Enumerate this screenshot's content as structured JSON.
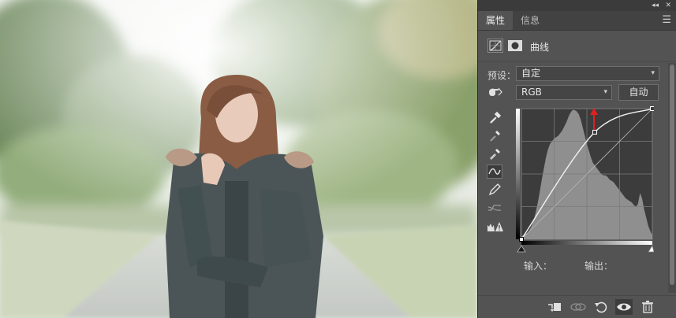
{
  "panel": {
    "tabs": [
      {
        "label": "属性"
      },
      {
        "label": "信息"
      }
    ],
    "adjustment_title": "曲线",
    "preset_label": "预设：",
    "preset_value": "自定",
    "channel_value": "RGB",
    "auto_label": "自动",
    "input_label": "输入：",
    "output_label": "输出："
  },
  "curve": {
    "points": [
      [
        0,
        0
      ],
      [
        0.56,
        0.82
      ],
      [
        1,
        1
      ]
    ],
    "histogram": [
      2,
      3,
      4,
      5,
      7,
      10,
      14,
      20,
      27,
      35,
      44,
      52,
      60,
      66,
      70,
      72,
      74,
      75,
      76,
      78,
      80,
      83,
      86,
      90,
      93,
      95,
      95,
      94,
      92,
      88,
      82,
      76,
      70,
      65,
      60,
      56,
      54,
      52,
      50,
      48,
      47,
      47,
      46,
      44,
      43,
      42,
      40,
      38,
      36,
      34,
      32,
      30,
      29,
      28,
      27,
      25,
      24,
      26,
      34,
      30,
      22,
      16,
      10,
      6,
      3
    ]
  },
  "colors": {
    "panel_bg": "#535353",
    "accent_arrow": "#e02020",
    "graph_bg": "#3c3c3c",
    "histogram_fill": "#8f8f8f"
  },
  "icons": [
    "curves-adjustment-icon",
    "mask-icon",
    "hand-target-icon",
    "black-eyedropper-icon",
    "gray-eyedropper-icon",
    "white-eyedropper-icon",
    "curve-edit-icon",
    "pencil-icon",
    "smooth-icon",
    "clipping-warning-icon",
    "clip-to-layer-icon",
    "view-previous-icon",
    "reset-icon",
    "visibility-eye-icon",
    "delete-trash-icon"
  ]
}
